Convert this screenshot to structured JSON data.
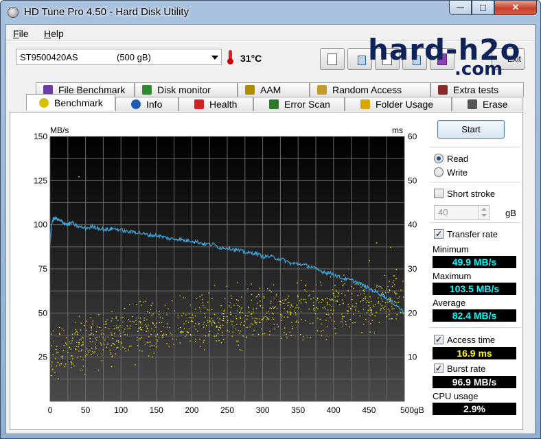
{
  "window": {
    "title": "HD Tune Pro 4.50 - Hard Disk Utility",
    "controls": {
      "minimize": "—",
      "maximize": "□",
      "close": "✕"
    }
  },
  "menu": {
    "file": "File",
    "help": "Help"
  },
  "toolbar": {
    "drive_name": "ST9500420AS",
    "drive_size": "(500 gB)",
    "temperature": "31°C",
    "exit_label": "Exit"
  },
  "watermark": {
    "line1": "hard-h2o",
    "line2": ".com"
  },
  "tabs_top": [
    {
      "label": "File Benchmark",
      "icon": "document-icon",
      "color": "#6b3fa0"
    },
    {
      "label": "Disk monitor",
      "icon": "monitor-chart-icon",
      "color": "#2f8a2f"
    },
    {
      "label": "AAM",
      "icon": "speaker-icon",
      "color": "#b08a00"
    },
    {
      "label": "Random Access",
      "icon": "scatter-icon",
      "color": "#c49a2a"
    },
    {
      "label": "Extra tests",
      "icon": "grid-icon",
      "color": "#8a2a2a"
    }
  ],
  "tabs_bottom": [
    {
      "label": "Benchmark",
      "icon": "bulb-icon",
      "color": "#d8c000"
    },
    {
      "label": "Info",
      "icon": "info-icon",
      "color": "#1e5cb3"
    },
    {
      "label": "Health",
      "icon": "health-cross-icon",
      "color": "#d42020"
    },
    {
      "label": "Error Scan",
      "icon": "magnifier-icon",
      "color": "#2a7a2a"
    },
    {
      "label": "Folder Usage",
      "icon": "folder-icon",
      "color": "#d8a800"
    },
    {
      "label": "Erase",
      "icon": "trash-icon",
      "color": "#555555"
    }
  ],
  "controls": {
    "start_label": "Start",
    "read_label": "Read",
    "write_label": "Write",
    "read_selected": true,
    "short_stroke_label": "Short stroke",
    "short_stroke_checked": false,
    "short_stroke_value": "40",
    "short_stroke_unit": "gB",
    "transfer_rate_label": "Transfer rate",
    "transfer_rate_checked": true,
    "access_time_label": "Access time",
    "access_time_checked": true,
    "burst_rate_label": "Burst rate",
    "burst_rate_checked": true
  },
  "stats": {
    "minimum_label": "Minimum",
    "minimum": "49.9 MB/s",
    "maximum_label": "Maximum",
    "maximum": "103.5 MB/s",
    "average_label": "Average",
    "average": "82.4 MB/s",
    "access_time": "16.9 ms",
    "burst_rate": "96.9 MB/s",
    "cpu_label": "CPU usage",
    "cpu": "2.9%",
    "colors": {
      "transfer": "#00ffff",
      "access": "#ffff00",
      "burst": "#ffffff",
      "cpu": "#ffffff"
    }
  },
  "chart_data": {
    "type": "line",
    "ylabel_left": "MB/s",
    "ylabel_right": "ms",
    "x_unit": "gB",
    "xlim": [
      0,
      500
    ],
    "ylim_left": [
      0,
      150
    ],
    "ylim_right": [
      0,
      60
    ],
    "x_ticks": [
      "0",
      "50",
      "100",
      "150",
      "200",
      "250",
      "300",
      "350",
      "400",
      "450",
      "500gB"
    ],
    "y_ticks_left": [
      "150",
      "125",
      "100",
      "75",
      "50",
      "25"
    ],
    "y_ticks_right": [
      "60",
      "50",
      "40",
      "30",
      "20",
      "10"
    ],
    "grid": true,
    "series": [
      {
        "kind": "transfer_rate_line",
        "color": "#3fa8e0",
        "x": [
          0,
          2,
          5,
          10,
          15,
          20,
          25,
          30,
          40,
          50,
          60,
          70,
          80,
          90,
          100,
          110,
          120,
          130,
          140,
          150,
          160,
          170,
          180,
          190,
          200,
          210,
          220,
          230,
          240,
          250,
          260,
          270,
          280,
          290,
          300,
          310,
          320,
          330,
          340,
          350,
          360,
          370,
          380,
          390,
          400,
          410,
          420,
          430,
          440,
          450,
          460,
          470,
          480,
          490,
          500
        ],
        "y": [
          88,
          100,
          104,
          103,
          102,
          101,
          100,
          101,
          99,
          98,
          99,
          98,
          97,
          98,
          97,
          96,
          96,
          95,
          94,
          94,
          93,
          92,
          92,
          91,
          91,
          90,
          89,
          89,
          87,
          87,
          86,
          85,
          84,
          84,
          82,
          82,
          81,
          80,
          78,
          78,
          77,
          76,
          74,
          73,
          72,
          70,
          69,
          68,
          66,
          64,
          62,
          60,
          57,
          54,
          50
        ]
      },
      {
        "kind": "access_time_scatter",
        "color": "#ffff00",
        "x_range": [
          0,
          500
        ],
        "trend_ms": [
          [
            0,
            11
          ],
          [
            100,
            15
          ],
          [
            200,
            18
          ],
          [
            300,
            20
          ],
          [
            400,
            21.5
          ],
          [
            500,
            23
          ]
        ],
        "spread_ms": 5
      }
    ]
  }
}
